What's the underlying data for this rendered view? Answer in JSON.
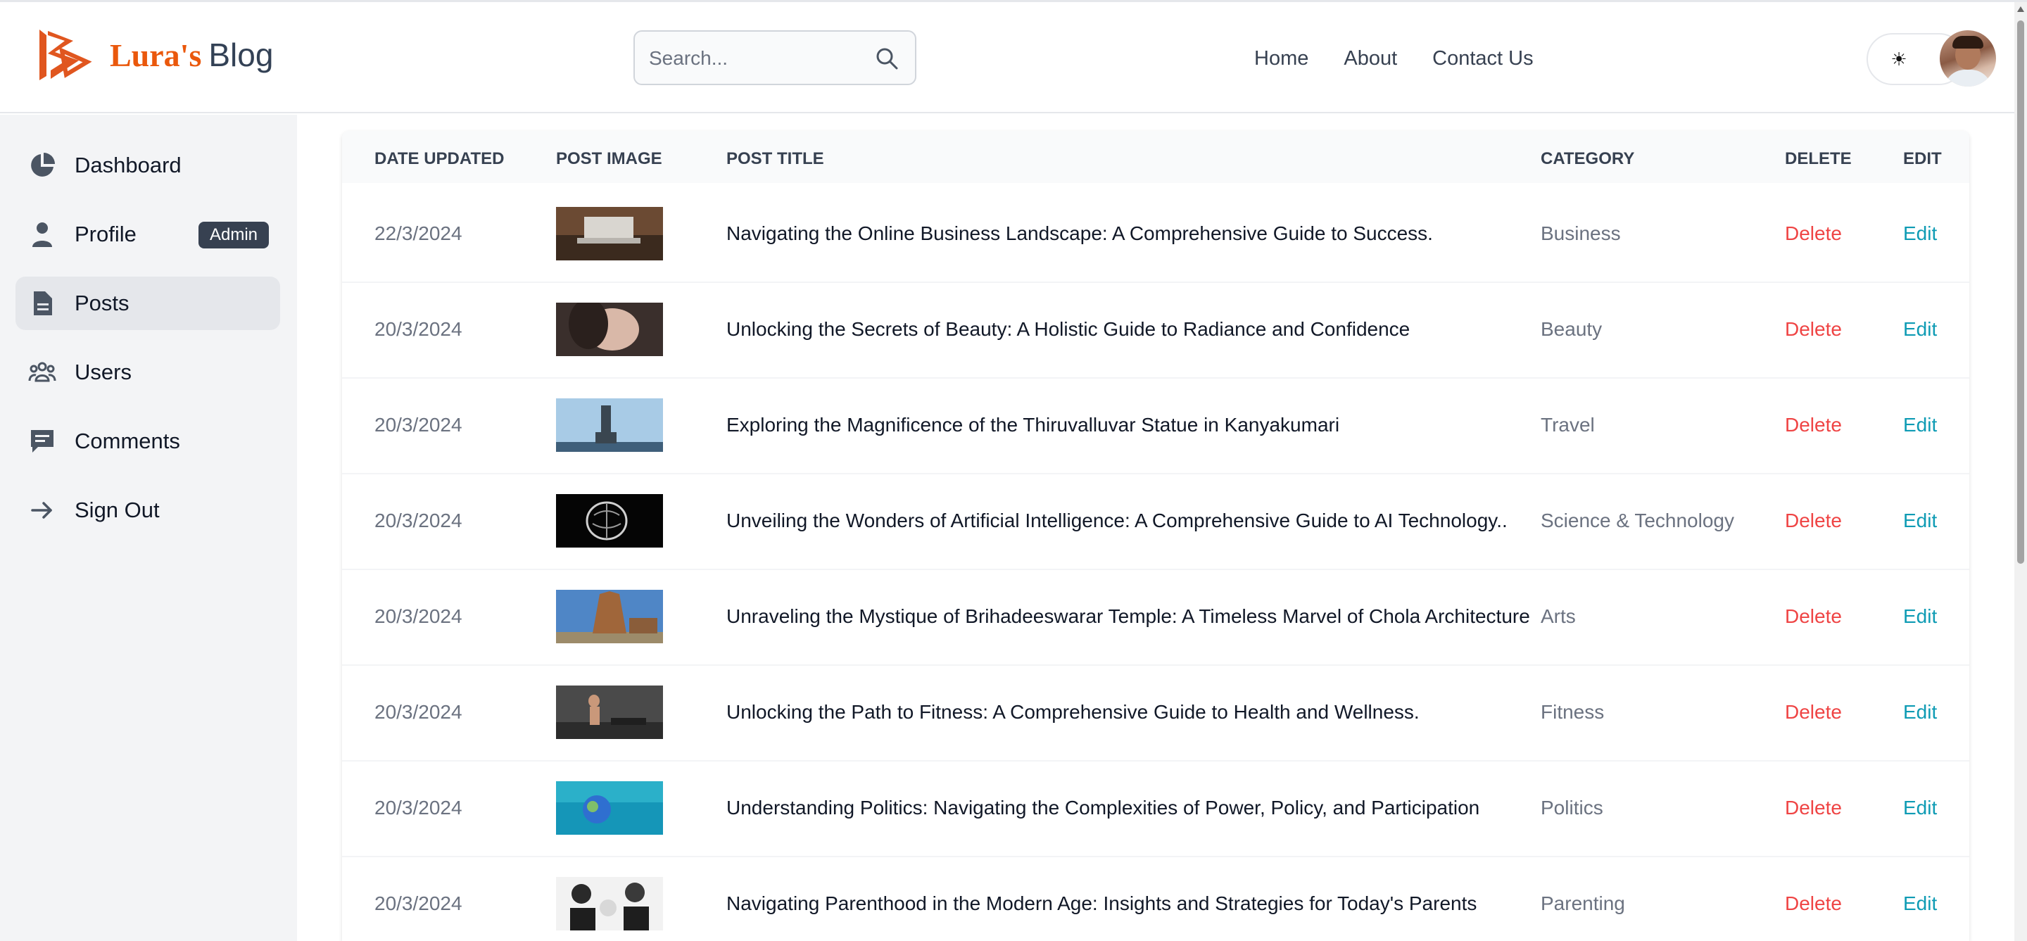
{
  "header": {
    "brand_part1": "Lura's",
    "brand_part2": "Blog",
    "search_placeholder": "Search...",
    "nav": [
      "Home",
      "About",
      "Contact Us"
    ],
    "theme_toggle_glyph": "☀"
  },
  "sidebar": {
    "items": [
      {
        "label": "Dashboard",
        "icon": "pie-chart-icon"
      },
      {
        "label": "Profile",
        "icon": "user-icon",
        "badge": "Admin"
      },
      {
        "label": "Posts",
        "icon": "document-icon",
        "active": true
      },
      {
        "label": "Users",
        "icon": "users-icon"
      },
      {
        "label": "Comments",
        "icon": "comment-icon"
      },
      {
        "label": "Sign Out",
        "icon": "arrow-right-icon"
      }
    ]
  },
  "table": {
    "headers": [
      "DATE UPDATED",
      "POST IMAGE",
      "POST TITLE",
      "CATEGORY",
      "DELETE",
      "EDIT"
    ],
    "rows": [
      {
        "date": "22/3/2024",
        "title": "Navigating the Online Business Landscape: A Comprehensive Guide to Success.",
        "category": "Business",
        "delete": "Delete",
        "edit": "Edit"
      },
      {
        "date": "20/3/2024",
        "title": "Unlocking the Secrets of Beauty: A Holistic Guide to Radiance and Confidence",
        "category": "Beauty",
        "delete": "Delete",
        "edit": "Edit"
      },
      {
        "date": "20/3/2024",
        "title": "Exploring the Magnificence of the Thiruvalluvar Statue in Kanyakumari",
        "category": "Travel",
        "delete": "Delete",
        "edit": "Edit"
      },
      {
        "date": "20/3/2024",
        "title": "Unveiling the Wonders of Artificial Intelligence: A Comprehensive Guide to AI Technology..",
        "category": "Science & Technology",
        "delete": "Delete",
        "edit": "Edit"
      },
      {
        "date": "20/3/2024",
        "title": "Unraveling the Mystique of Brihadeeswarar Temple: A Timeless Marvel of Chola Architecture",
        "category": "Arts",
        "delete": "Delete",
        "edit": "Edit"
      },
      {
        "date": "20/3/2024",
        "title": "Unlocking the Path to Fitness: A Comprehensive Guide to Health and Wellness.",
        "category": "Fitness",
        "delete": "Delete",
        "edit": "Edit"
      },
      {
        "date": "20/3/2024",
        "title": "Understanding Politics: Navigating the Complexities of Power, Policy, and Participation",
        "category": "Politics",
        "delete": "Delete",
        "edit": "Edit"
      },
      {
        "date": "20/3/2024",
        "title": "Navigating Parenthood in the Modern Age: Insights and Strategies for Today's Parents",
        "category": "Parenting",
        "delete": "Delete",
        "edit": "Edit"
      }
    ]
  },
  "colors": {
    "brand_orange": "#ea580c",
    "delete_red": "#ef4444",
    "edit_teal": "#0e9bb4"
  }
}
